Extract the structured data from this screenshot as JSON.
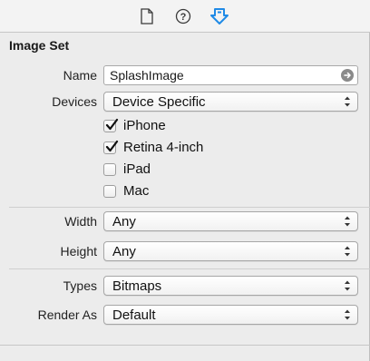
{
  "toolbar": {
    "icons": [
      "file-inspector-icon",
      "quick-help-icon",
      "attributes-inspector-icon"
    ],
    "active_color": "#1f8ae6"
  },
  "section": {
    "title": "Image Set"
  },
  "name_field": {
    "label": "Name",
    "value": "SplashImage"
  },
  "devices": {
    "label": "Devices",
    "selected": "Device Specific",
    "options": [
      {
        "label": "iPhone",
        "checked": true
      },
      {
        "label": "Retina 4-inch",
        "checked": true
      },
      {
        "label": "iPad",
        "checked": false
      },
      {
        "label": "Mac",
        "checked": false
      }
    ]
  },
  "width": {
    "label": "Width",
    "selected": "Any"
  },
  "height": {
    "label": "Height",
    "selected": "Any"
  },
  "types": {
    "label": "Types",
    "selected": "Bitmaps"
  },
  "render_as": {
    "label": "Render As",
    "selected": "Default"
  }
}
